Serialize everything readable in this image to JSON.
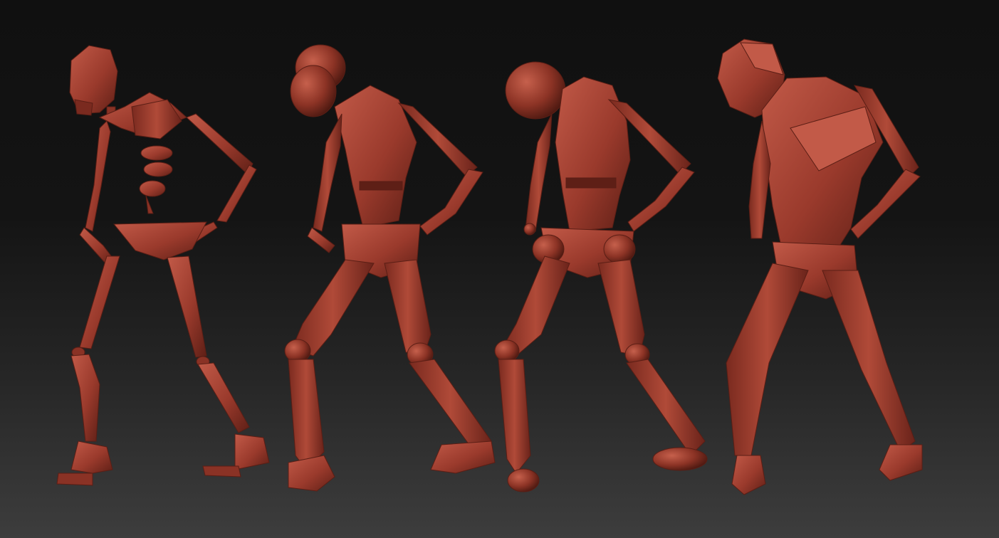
{
  "scene": {
    "subject": "four-clay-mannequin-poses",
    "colors": {
      "background_top": "#101010",
      "background_bottom": "#3d3d3d",
      "clay": "#9a3a2c",
      "clay_light": "#c25a48",
      "clay_dark": "#5e1f16"
    },
    "figures": [
      {
        "name": "skeleton-figure"
      },
      {
        "name": "segmented-mannequin-figure"
      },
      {
        "name": "ball-joint-mannequin-figure"
      },
      {
        "name": "lowpoly-body-figure"
      }
    ]
  }
}
